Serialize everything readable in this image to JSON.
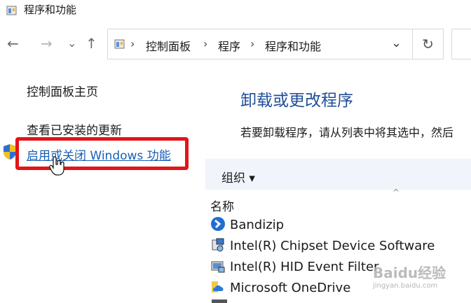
{
  "window": {
    "title": "程序和功能"
  },
  "nav": {
    "back": "←",
    "forward": "→",
    "recent": "⌄",
    "up": "↑"
  },
  "address": {
    "segments": [
      "控制面板",
      "程序",
      "程序和功能"
    ],
    "separator": "›",
    "dropdown": "⌄",
    "refresh": "↻"
  },
  "sidebar": {
    "items": [
      {
        "label": "控制面板主页"
      },
      {
        "label": "查看已安装的更新"
      },
      {
        "label": "启用或关闭 Windows 功能"
      }
    ]
  },
  "main": {
    "heading": "卸载或更改程序",
    "description": "若要卸载程序，请从列表中将其选中，然后",
    "toolbar": {
      "organize": "组织 ▾"
    },
    "columns": {
      "name": "名称",
      "sort_indicator": "^"
    },
    "programs": [
      {
        "name": "Bandizip"
      },
      {
        "name": "Intel(R) Chipset Device Software"
      },
      {
        "name": "Intel(R) HID Event Filter"
      },
      {
        "name": "Microsoft OneDrive"
      }
    ]
  },
  "watermark": {
    "text": "Baidu经验",
    "sub": "jingyan.baidu.com"
  },
  "colors": {
    "heading": "#1f4e9a",
    "highlight": "#e2151b",
    "link": "#1a5fb4"
  }
}
